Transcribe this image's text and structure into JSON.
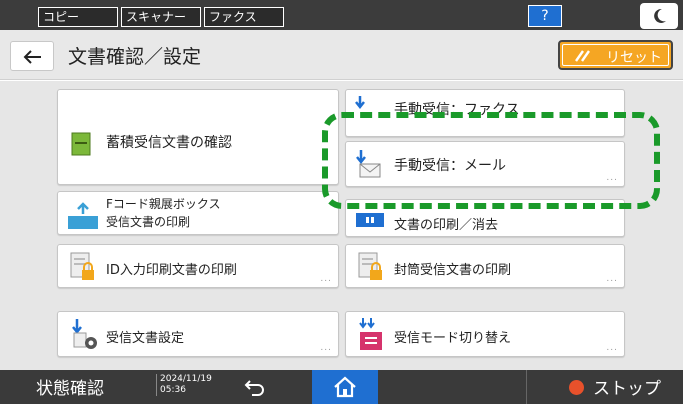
{
  "topbar": {
    "tabs": [
      "コピー",
      "スキャナー",
      "ファクス"
    ],
    "help_label": "?"
  },
  "header": {
    "title": "文書確認／設定",
    "reset_label": "リセット"
  },
  "cards": {
    "stored_docs": "蓄積受信文書の確認",
    "manual_fax": "手動受信：ファクス",
    "manual_mail": "手動受信：メール",
    "fcode_line1": "Fコード親展ボックス",
    "fcode_line2": "受信文書の印刷",
    "print_delete": "文書の印刷／消去",
    "id_print": "ID入力印刷文書の印刷",
    "envelope_print": "封筒受信文書の印刷",
    "receive_settings": "受信文書設定",
    "receive_mode": "受信モード切り替え",
    "more": "..."
  },
  "bottombar": {
    "status_label": "状態確認",
    "date": "2024/11/19",
    "time": "05:36",
    "stop_label": "ストップ"
  },
  "colors": {
    "accent_blue": "#1f6fd1",
    "reset_orange": "#f5a623",
    "highlight_green": "#1a9a2a",
    "stop_red": "#e8512b"
  }
}
